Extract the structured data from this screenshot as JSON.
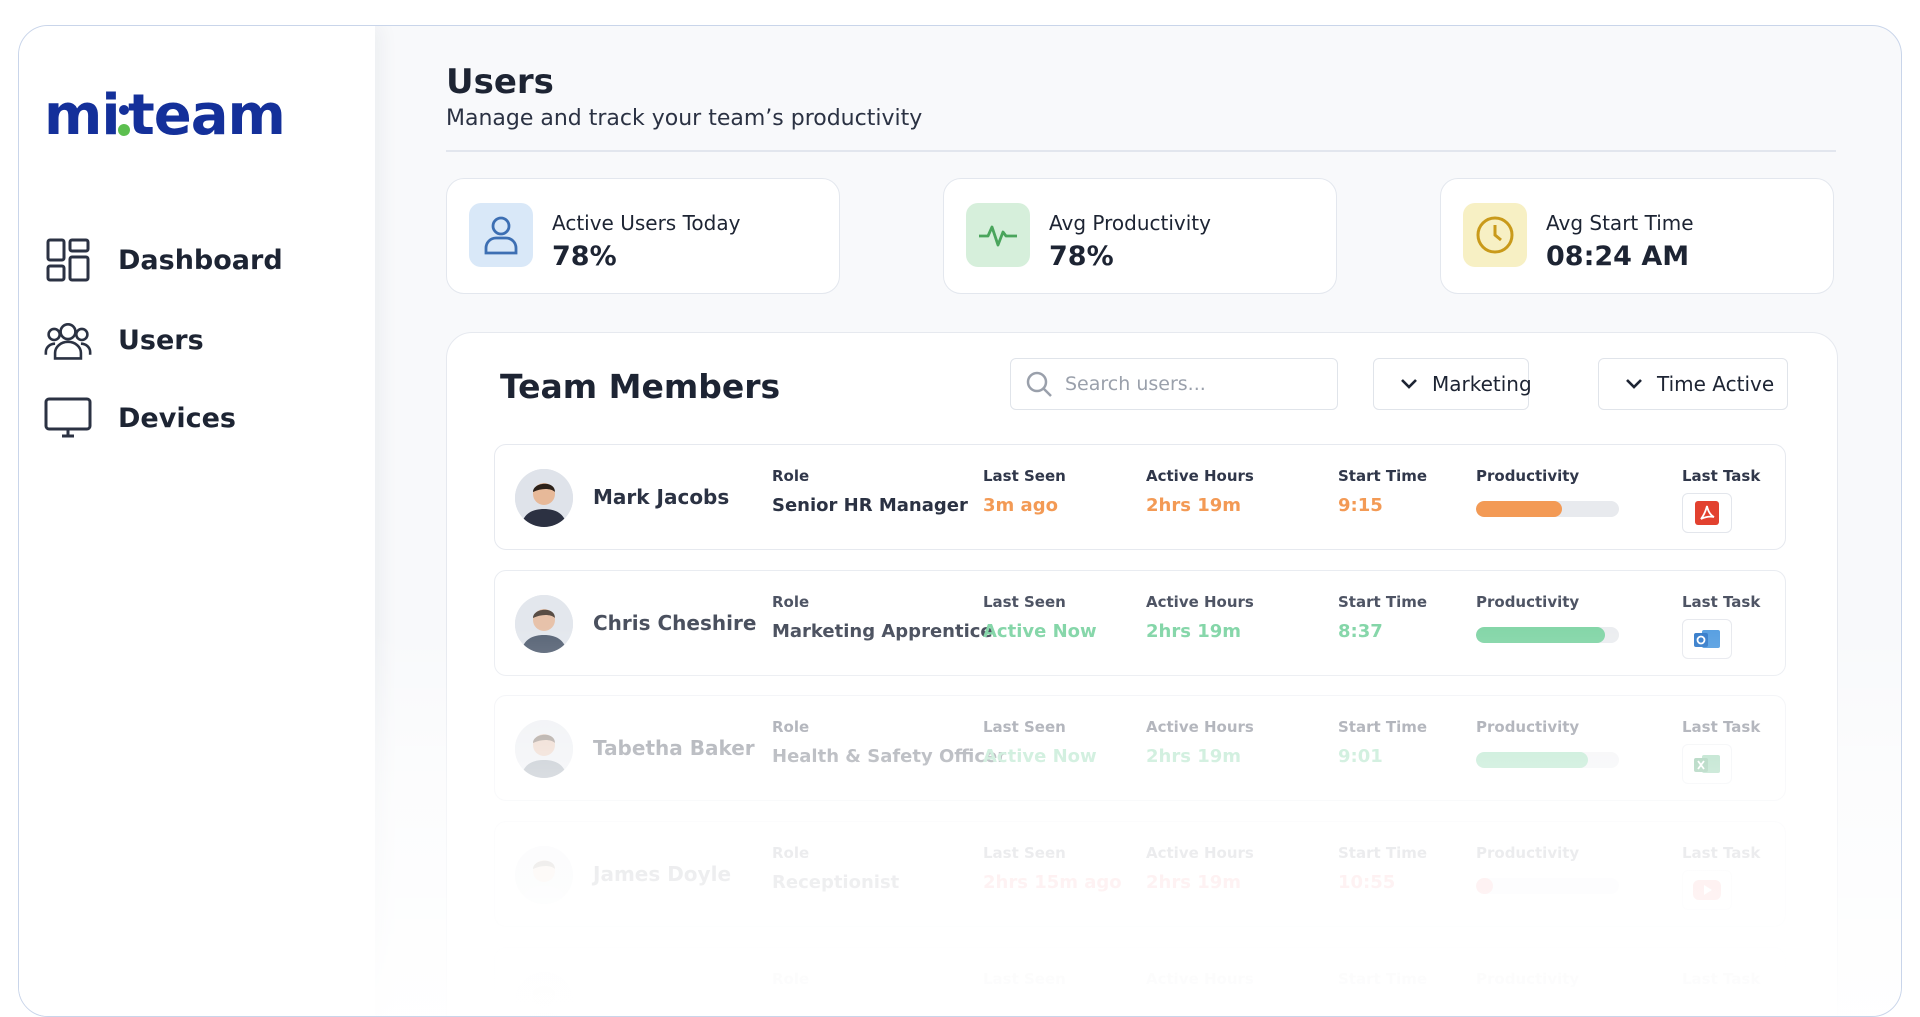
{
  "app": {
    "logo_text": "mi:team",
    "brand_color": "#14309a",
    "accent_green": "#5cbf4f"
  },
  "sidebar": {
    "items": [
      {
        "label": "Dashboard",
        "icon": "dashboard-icon"
      },
      {
        "label": "Users",
        "icon": "users-icon"
      },
      {
        "label": "Devices",
        "icon": "monitor-icon"
      }
    ]
  },
  "header": {
    "title": "Users",
    "subtitle": "Manage and track your team’s productivity"
  },
  "stats": [
    {
      "label": "Active Users Today",
      "value": "78%",
      "icon": "user-icon",
      "color": "#d9e8f8"
    },
    {
      "label": "Avg Productivity",
      "value": "78%",
      "icon": "heartbeat-icon",
      "color": "#d6efdb"
    },
    {
      "label": "Avg Start Time",
      "value": "08:24 AM",
      "icon": "clock-icon",
      "color": "#f7f0c4"
    }
  ],
  "team": {
    "title": "Team Members",
    "search_placeholder": "Search users...",
    "filter_department": "Marketing",
    "filter_sort": "Time Active",
    "headers": {
      "role": "Role",
      "last_seen": "Last Seen",
      "active_hours": "Active Hours",
      "start_time": "Start Time",
      "productivity": "Productivity",
      "last_task": "Last Task"
    },
    "members": [
      {
        "name": "Mark Jacobs",
        "role": "Senior HR Manager",
        "last_seen": "3m ago",
        "active_hours": "2hrs 19m",
        "start_time": "9:15",
        "productivity": 0.6,
        "status_color": "#f39a55",
        "last_task_icon": "pdf-icon"
      },
      {
        "name": "Chris Cheshire",
        "role": "Marketing Apprentice",
        "last_seen": "Active Now",
        "active_hours": "2hrs 19m",
        "start_time": "8:37",
        "productivity": 0.9,
        "status_color": "#6fcf9a",
        "last_task_icon": "outlook-icon"
      },
      {
        "name": "Tabetha Baker",
        "role": "Health & Safety Officer",
        "last_seen": "Active Now",
        "active_hours": "2hrs 19m",
        "start_time": "9:01",
        "productivity": 0.78,
        "status_color": "#6fcf9a",
        "last_task_icon": "excel-icon"
      },
      {
        "name": "James Doyle",
        "role": "Receptionist",
        "last_seen": "2hrs 15m ago",
        "active_hours": "2hrs 19m",
        "start_time": "10:55",
        "productivity": 0.12,
        "status_color": "#ef5b66",
        "last_task_icon": "youtube-icon"
      },
      {
        "name": "",
        "role": "",
        "last_seen": "",
        "active_hours": "",
        "start_time": "",
        "productivity": 0,
        "status_color": "#cccccc",
        "last_task_icon": ""
      }
    ]
  }
}
